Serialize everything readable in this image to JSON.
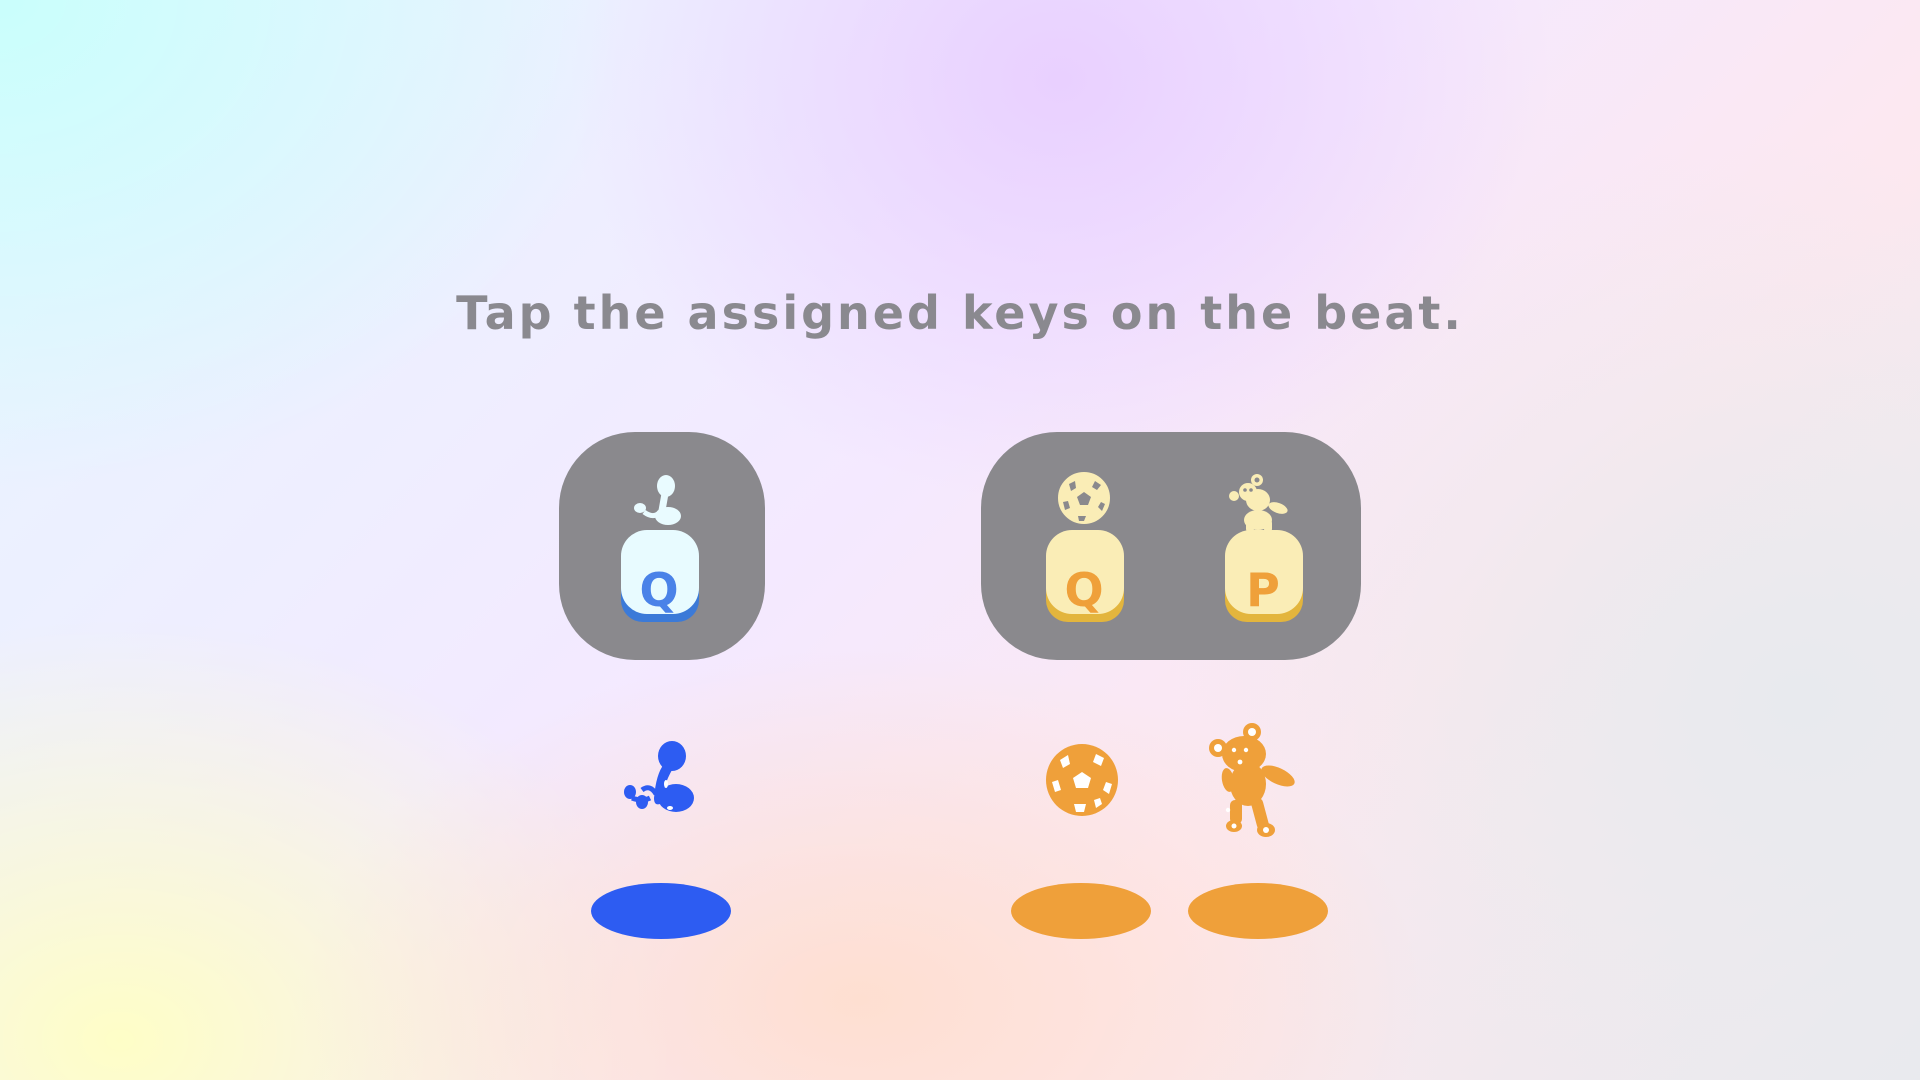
{
  "instruction": "Tap the assigned keys on the beat.",
  "colors": {
    "blue": "#2d5cf2",
    "orange": "#efa03a",
    "panel": "#8a898d",
    "key_blue_face": "#e8fbff",
    "key_blue_edge": "#3b7ad8",
    "key_orange_face": "#faedb6",
    "key_orange_edge": "#e3b53d"
  },
  "players": [
    {
      "group": "left",
      "key": "Q",
      "icon": "maracas-icon",
      "color": "blue"
    },
    {
      "group": "right",
      "key": "Q",
      "icon": "soccer-ball-icon",
      "color": "orange"
    },
    {
      "group": "right",
      "key": "P",
      "icon": "teddy-bear-icon",
      "color": "orange"
    }
  ]
}
